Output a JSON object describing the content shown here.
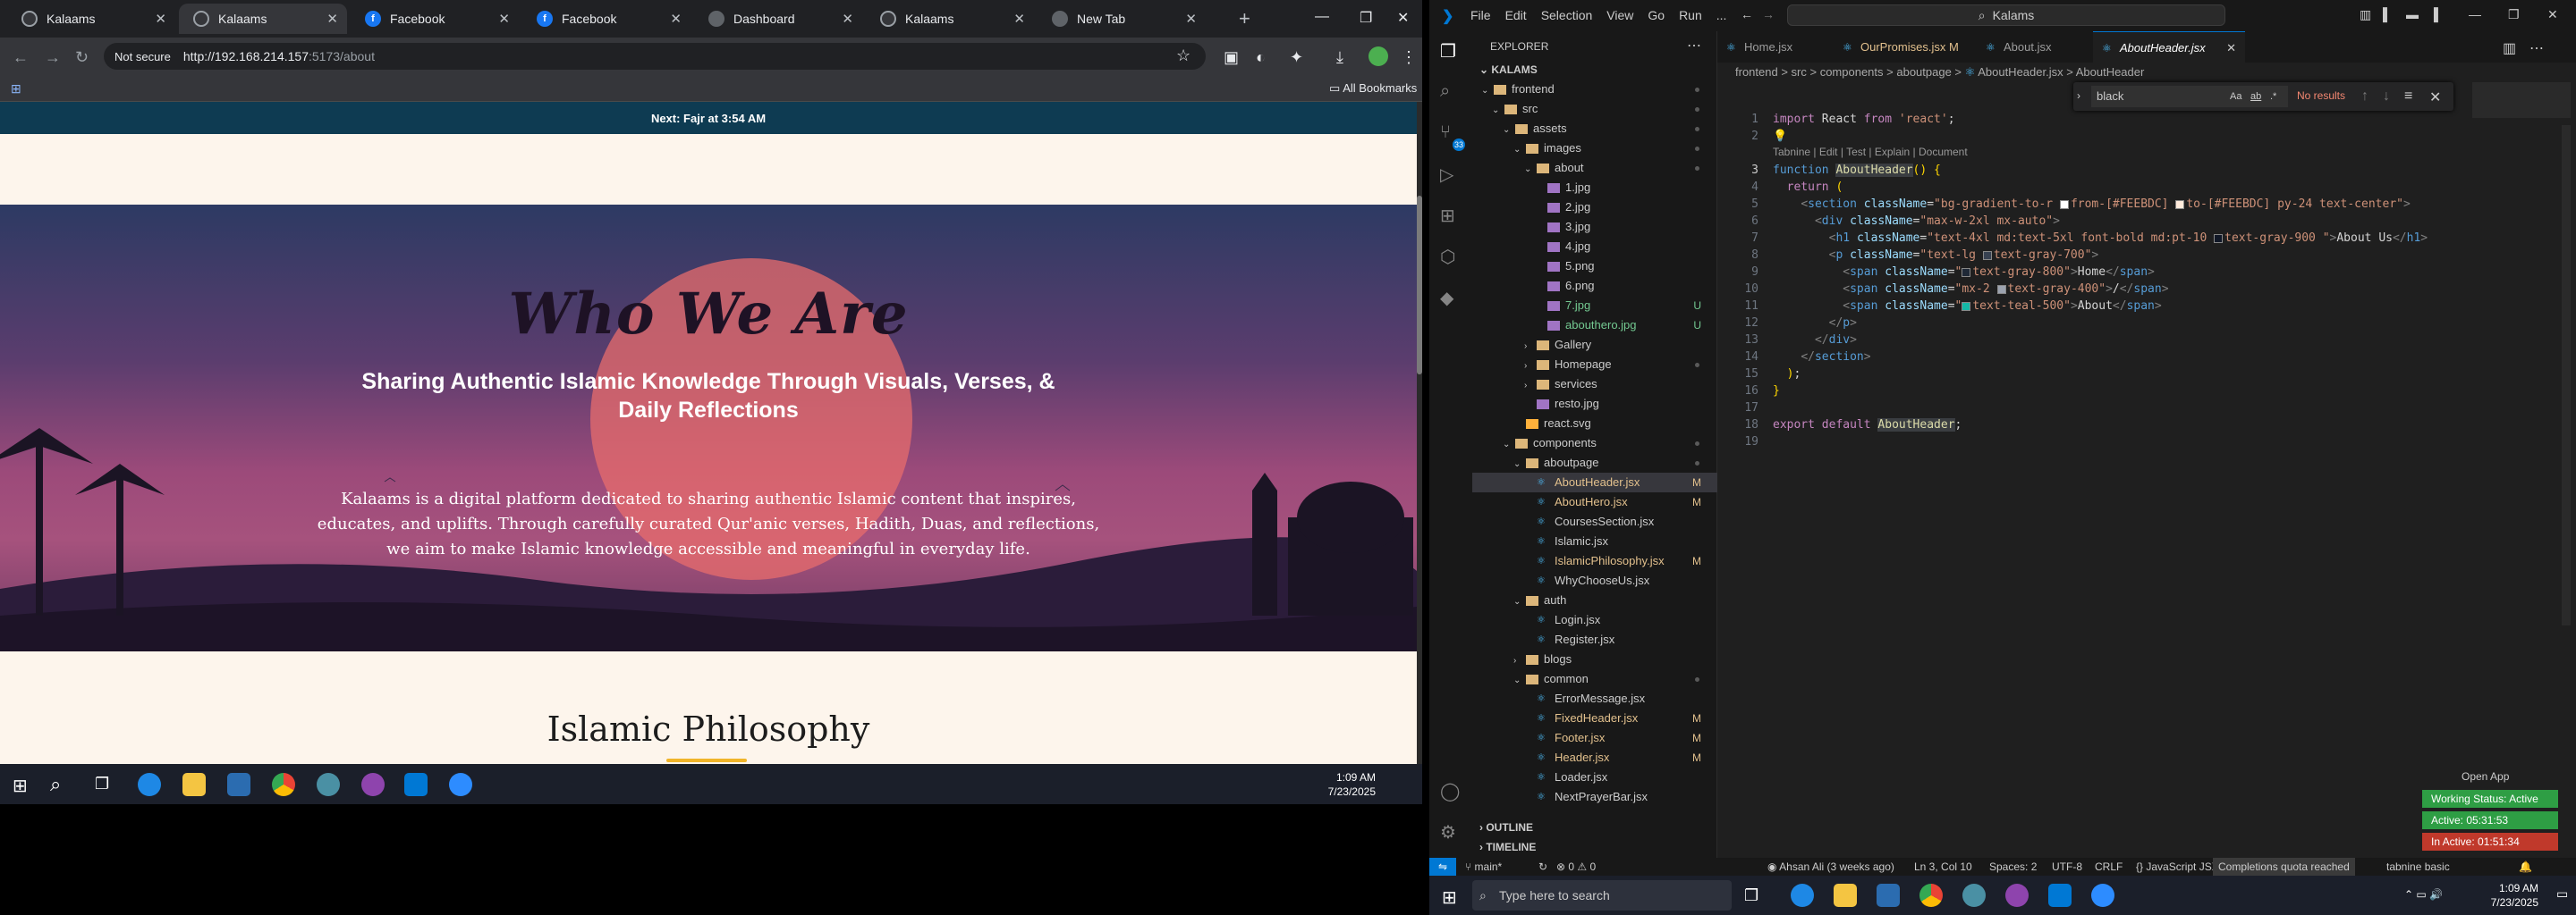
{
  "browser": {
    "tabs": [
      {
        "title": "Kalaams",
        "favicon": "k"
      },
      {
        "title": "Kalaams",
        "favicon": "k",
        "active": true
      },
      {
        "title": "Facebook",
        "favicon": "f"
      },
      {
        "title": "Facebook",
        "favicon": "f"
      },
      {
        "title": "Dashboard",
        "favicon": "d"
      },
      {
        "title": "Kalaams",
        "favicon": "k"
      },
      {
        "title": "New Tab",
        "favicon": "n"
      }
    ],
    "security": "Not secure",
    "url_host": "http://192.168.214.157",
    "url_path": ":5173/about",
    "bookmarks_label": "All Bookmarks"
  },
  "page": {
    "prayer_banner": "Next: Fajr at 3:54 AM",
    "hero_title": "Who We Are",
    "hero_subtitle": "Sharing Authentic Islamic Knowledge Through Visuals, Verses, & Daily Reflections",
    "hero_paragraph": "Kalaams is a digital platform dedicated to sharing authentic Islamic content that inspires, educates, and uplifts. Through carefully curated Qur'anic verses, Hadith, Duas, and reflections, we aim to make Islamic knowledge accessible and meaningful in everyday life.",
    "section2_title": "Islamic Philosophy"
  },
  "taskbar_left": {
    "time": "1:09 AM",
    "date": "7/23/2025"
  },
  "vscode": {
    "menu": [
      "File",
      "Edit",
      "Selection",
      "View",
      "Go",
      "Run",
      "..."
    ],
    "command_center": "Kalams",
    "explorer_title": "EXPLORER",
    "workspace": "KALAMS",
    "tree": [
      {
        "label": "frontend",
        "kind": "folder",
        "depth": 0,
        "open": true,
        "dot": true
      },
      {
        "label": "src",
        "kind": "folder",
        "depth": 1,
        "open": true,
        "dot": true
      },
      {
        "label": "assets",
        "kind": "folder",
        "depth": 2,
        "open": true,
        "dot": true
      },
      {
        "label": "images",
        "kind": "folder",
        "depth": 3,
        "open": true,
        "dot": true
      },
      {
        "label": "about",
        "kind": "folder",
        "depth": 4,
        "open": true,
        "dot": true
      },
      {
        "label": "1.jpg",
        "kind": "img",
        "depth": 5
      },
      {
        "label": "2.jpg",
        "kind": "img",
        "depth": 5
      },
      {
        "label": "3.jpg",
        "kind": "img",
        "depth": 5
      },
      {
        "label": "4.jpg",
        "kind": "img",
        "depth": 5
      },
      {
        "label": "5.png",
        "kind": "img",
        "depth": 5
      },
      {
        "label": "6.png",
        "kind": "img",
        "depth": 5
      },
      {
        "label": "7.jpg",
        "kind": "img",
        "depth": 5,
        "status": "U"
      },
      {
        "label": "abouthero.jpg",
        "kind": "img",
        "depth": 5,
        "status": "U"
      },
      {
        "label": "Gallery",
        "kind": "folder",
        "depth": 4,
        "open": false
      },
      {
        "label": "Homepage",
        "kind": "folder",
        "depth": 4,
        "open": false,
        "dot": true
      },
      {
        "label": "services",
        "kind": "folder",
        "depth": 4,
        "open": false
      },
      {
        "label": "resto.jpg",
        "kind": "img",
        "depth": 4
      },
      {
        "label": "react.svg",
        "kind": "svg",
        "depth": 3
      },
      {
        "label": "components",
        "kind": "folder",
        "depth": 2,
        "open": true,
        "dot": true
      },
      {
        "label": "aboutpage",
        "kind": "folder",
        "depth": 3,
        "open": true,
        "dot": true
      },
      {
        "label": "AboutHeader.jsx",
        "kind": "jsx",
        "depth": 4,
        "status": "M",
        "selected": true
      },
      {
        "label": "AboutHero.jsx",
        "kind": "jsx",
        "depth": 4,
        "status": "M"
      },
      {
        "label": "CoursesSection.jsx",
        "kind": "jsx",
        "depth": 4
      },
      {
        "label": "Islamic.jsx",
        "kind": "jsx",
        "depth": 4
      },
      {
        "label": "IslamicPhilosophy.jsx",
        "kind": "jsx",
        "depth": 4,
        "status": "M"
      },
      {
        "label": "WhyChooseUs.jsx",
        "kind": "jsx",
        "depth": 4
      },
      {
        "label": "auth",
        "kind": "folder",
        "depth": 3,
        "open": true
      },
      {
        "label": "Login.jsx",
        "kind": "jsx",
        "depth": 4
      },
      {
        "label": "Register.jsx",
        "kind": "jsx",
        "depth": 4
      },
      {
        "label": "blogs",
        "kind": "folder",
        "depth": 3,
        "open": false
      },
      {
        "label": "common",
        "kind": "folder",
        "depth": 3,
        "open": true,
        "dot": true
      },
      {
        "label": "ErrorMessage.jsx",
        "kind": "jsx",
        "depth": 4
      },
      {
        "label": "FixedHeader.jsx",
        "kind": "jsx",
        "depth": 4,
        "status": "M"
      },
      {
        "label": "Footer.jsx",
        "kind": "jsx",
        "depth": 4,
        "status": "M"
      },
      {
        "label": "Header.jsx",
        "kind": "jsx",
        "depth": 4,
        "status": "M"
      },
      {
        "label": "Loader.jsx",
        "kind": "jsx",
        "depth": 4
      },
      {
        "label": "NextPrayerBar.jsx",
        "kind": "jsx",
        "depth": 4
      }
    ],
    "outline_label": "OUTLINE",
    "timeline_label": "TIMELINE",
    "editor_tabs": [
      {
        "label": "Home.jsx",
        "modified": false
      },
      {
        "label": "OurPromises.jsx",
        "modified": true,
        "badge": "M"
      },
      {
        "label": "About.jsx",
        "modified": false
      },
      {
        "label": "AboutHeader.jsx",
        "modified": false,
        "active": true
      }
    ],
    "breadcrumbs": [
      "frontend",
      "src",
      "components",
      "aboutpage",
      "AboutHeader.jsx",
      "AboutHeader"
    ],
    "find": {
      "query": "black",
      "result": "No results",
      "opt_case": "Aa",
      "opt_word": "ab",
      "opt_regex": ".*"
    },
    "codelens": "Tabnine | Edit | Test | Explain | Document",
    "status": {
      "branch": "main*",
      "problems": "0 ⚠ 0",
      "author": "Ahsan Ali (3 weeks ago)",
      "cursor": "Ln 3, Col 10",
      "spaces": "Spaces: 2",
      "encoding": "UTF-8",
      "eol": "CRLF",
      "language": "JavaScript JSX",
      "quota": "Completions quota reached",
      "tabnine": "tabnine basic"
    },
    "open_app": "Open App",
    "timers": [
      {
        "label": "Working Status: Active",
        "color": "#2e9e44"
      },
      {
        "label": "Active: 05:31:53",
        "color": "#2e9e44"
      },
      {
        "label": "In Active: 01:51:34",
        "color": "#c0392b"
      }
    ]
  },
  "taskbar_right": {
    "search_placeholder": "Type here to search",
    "time": "1:09 AM",
    "date": "7/23/2025"
  },
  "colors": {
    "accent": "#0078d4",
    "modified": "#e2c08d",
    "untracked": "#73c991",
    "banner": "#0e3b52",
    "underline": "#f0b429"
  }
}
